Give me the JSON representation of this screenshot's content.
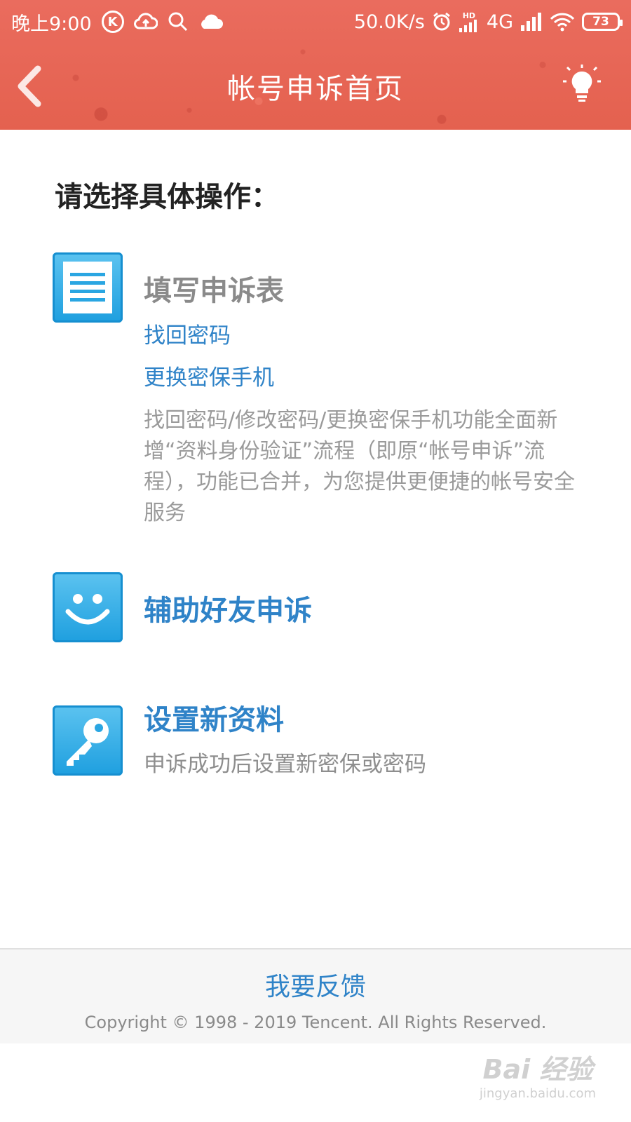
{
  "status_bar": {
    "time": "晚上9:00",
    "k_badge": "K",
    "net_speed": "50.0K/s",
    "hd_label": "HD",
    "network": "4G",
    "battery": "73"
  },
  "header": {
    "title": "帐号申诉首页",
    "back_icon": "chevron-left-icon",
    "tip_icon": "lightbulb-icon"
  },
  "main": {
    "heading": "请选择具体操作：",
    "options": [
      {
        "icon": "form-document-icon",
        "title": "填写申诉表",
        "links": [
          "找回密码",
          "更换密保手机"
        ],
        "description": "找回密码/修改密码/更换密保手机功能全面新增“资料身份验证”流程（即原“帐号申诉”流程），功能已合并，为您提供更便捷的帐号安全服务"
      },
      {
        "icon": "smiley-face-icon",
        "title": "辅助好友申诉"
      },
      {
        "icon": "key-icon",
        "title": "设置新资料",
        "subtitle": "申诉成功后设置新密保或密码"
      }
    ]
  },
  "footer": {
    "feedback": "我要反馈",
    "copyright": "Copyright © 1998 - 2019 Tencent. All Rights Reserved."
  },
  "watermark": {
    "main": "Bai 经验",
    "sub": "jingyan.baidu.com"
  },
  "colors": {
    "header_bg": "#e8685a",
    "link_blue": "#2f83c8",
    "icon_blue": "#1e9fdf"
  }
}
